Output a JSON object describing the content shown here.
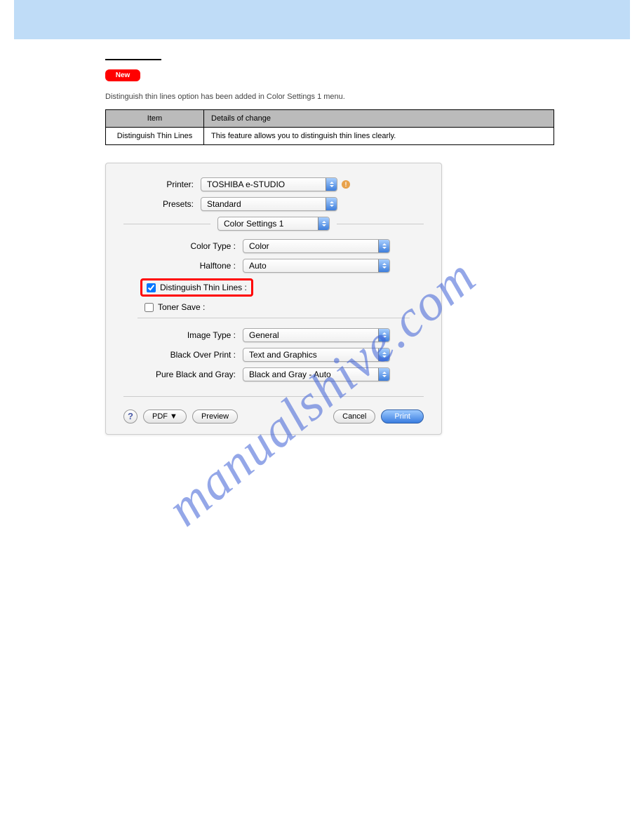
{
  "banner": {
    "title": ""
  },
  "section": {
    "label": "",
    "badge": "New"
  },
  "description": "Distinguish thin lines option has been added in Color Settings 1 menu.",
  "table": {
    "headers": [
      "Item",
      "Details of change"
    ],
    "rows": [
      [
        "Distinguish Thin Lines",
        "This feature allows you to distinguish thin lines clearly."
      ]
    ]
  },
  "dialog": {
    "printer": {
      "label": "Printer:",
      "value": "TOSHIBA e-STUDIO"
    },
    "presets": {
      "label": "Presets:",
      "value": "Standard"
    },
    "panel": {
      "value": "Color Settings 1"
    },
    "colorType": {
      "label": "Color Type :",
      "value": "Color"
    },
    "halftone": {
      "label": "Halftone :",
      "value": "Auto"
    },
    "distinguish": {
      "label": "Distinguish Thin Lines :",
      "checked": true
    },
    "tonerSave": {
      "label": "Toner Save :",
      "checked": false
    },
    "imageType": {
      "label": "Image Type :",
      "value": "General"
    },
    "blackOverPrint": {
      "label": "Black Over Print :",
      "value": "Text and Graphics"
    },
    "pureBlackGray": {
      "label": "Pure Black and Gray:",
      "value": "Black and Gray - Auto"
    },
    "buttons": {
      "help": "?",
      "pdf": "PDF ▼",
      "preview": "Preview",
      "cancel": "Cancel",
      "print": "Print"
    }
  },
  "watermark": "manualshive.com"
}
